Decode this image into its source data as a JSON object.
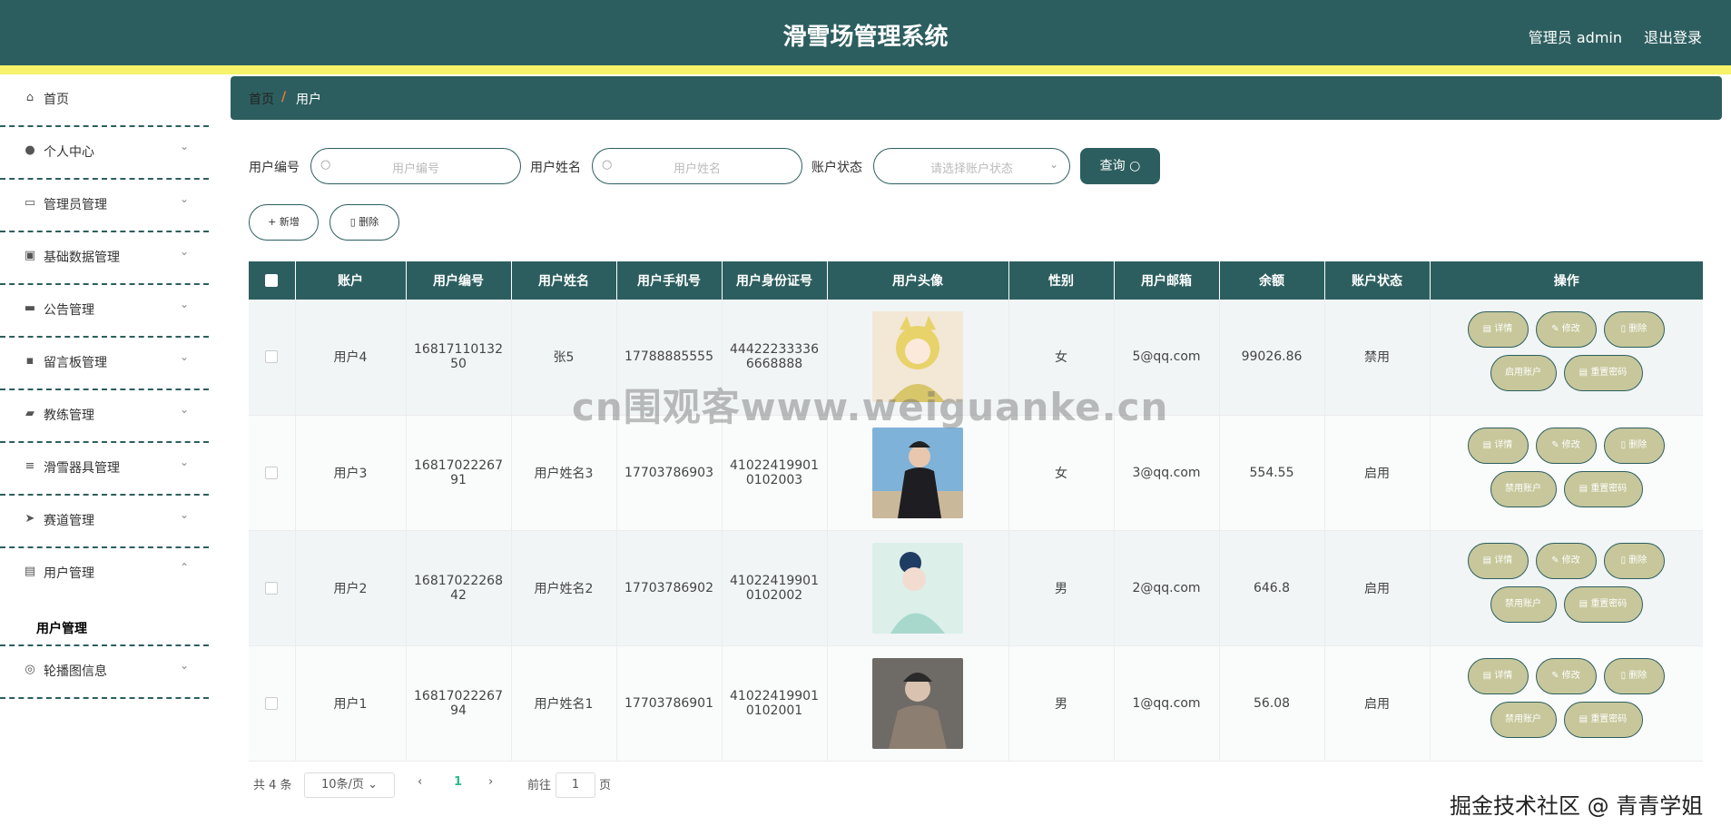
{
  "header": {
    "title": "滑雪场管理系统",
    "user": "管理员 admin",
    "logout": "退出登录"
  },
  "sidebar": {
    "items": [
      {
        "label": "首页",
        "icon": "home-icon",
        "glyph": "⌂",
        "arrow": ""
      },
      {
        "label": "个人中心",
        "icon": "person-icon",
        "glyph": "●",
        "arrow": "⌄"
      },
      {
        "label": "管理员管理",
        "icon": "chat-icon",
        "glyph": "▭",
        "arrow": "⌄"
      },
      {
        "label": "基础数据管理",
        "icon": "clipboard-icon",
        "glyph": "▣",
        "arrow": "⌄"
      },
      {
        "label": "公告管理",
        "icon": "podium-icon",
        "glyph": "▬",
        "arrow": "⌄"
      },
      {
        "label": "留言板管理",
        "icon": "message-icon",
        "glyph": "▪",
        "arrow": "⌄"
      },
      {
        "label": "教练管理",
        "icon": "truck-icon",
        "glyph": "▰",
        "arrow": "⌄"
      },
      {
        "label": "滑雪器具管理",
        "icon": "list-icon",
        "glyph": "≡",
        "arrow": "⌄"
      },
      {
        "label": "赛道管理",
        "icon": "send-icon",
        "glyph": "➤",
        "arrow": "⌄"
      },
      {
        "label": "用户管理",
        "icon": "doc-icon",
        "glyph": "▤",
        "arrow": "⌃"
      },
      {
        "label": "轮播图信息",
        "icon": "gauge-icon",
        "glyph": "◎",
        "arrow": "⌄"
      }
    ],
    "submenu_label": "用户管理"
  },
  "breadcrumb": {
    "home": "首页",
    "sep": "/",
    "current": "用户"
  },
  "search": {
    "id_label": "用户编号",
    "id_placeholder": "用户编号",
    "name_label": "用户姓名",
    "name_placeholder": "用户姓名",
    "status_label": "账户状态",
    "status_placeholder": "请选择账户状态",
    "query_label": "查询"
  },
  "actions": {
    "add": "+ 新增",
    "delete": "删除"
  },
  "table": {
    "headers": [
      "账户",
      "用户编号",
      "用户姓名",
      "用户手机号",
      "用户身份证号",
      "用户头像",
      "性别",
      "用户邮箱",
      "余额",
      "账户状态",
      "操作"
    ],
    "rows": [
      {
        "account": "用户4",
        "id_a": "16817110132",
        "id_b": "50",
        "name": "张5",
        "phone": "17788885555",
        "idcard_a": "44422233336",
        "idcard_b": "6668888",
        "gender": "女",
        "email": "5@qq.com",
        "balance": "99026.86",
        "status": "禁用",
        "toggle": "启用账户"
      },
      {
        "account": "用户3",
        "id_a": "16817022267",
        "id_b": "91",
        "name": "用户姓名3",
        "phone": "17703786903",
        "idcard_a": "41022419901",
        "idcard_b": "0102003",
        "gender": "女",
        "email": "3@qq.com",
        "balance": "554.55",
        "status": "启用",
        "toggle": "禁用账户"
      },
      {
        "account": "用户2",
        "id_a": "16817022268",
        "id_b": "42",
        "name": "用户姓名2",
        "phone": "17703786902",
        "idcard_a": "41022419901",
        "idcard_b": "0102002",
        "gender": "男",
        "email": "2@qq.com",
        "balance": "646.8",
        "status": "启用",
        "toggle": "禁用账户"
      },
      {
        "account": "用户1",
        "id_a": "16817022267",
        "id_b": "94",
        "name": "用户姓名1",
        "phone": "17703786901",
        "idcard_a": "41022419901",
        "idcard_b": "0102001",
        "gender": "男",
        "email": "1@qq.com",
        "balance": "56.08",
        "status": "启用",
        "toggle": "禁用账户"
      }
    ],
    "op_labels": {
      "detail": "详情",
      "edit": "修改",
      "delete": "删除",
      "reset": "重置密码"
    }
  },
  "pagination": {
    "total": "共 4 条",
    "page_size": "10条/页",
    "current": "1",
    "goto_prefix": "前往",
    "goto_value": "1",
    "goto_suffix": "页"
  },
  "watermarks": {
    "center": "cn围观客www.weiguanke.cn",
    "bottom_right": "掘金技术社区 @ 青青学姐"
  },
  "colors": {
    "primary": "#2d5e5f",
    "accent_yellow": "#f6f36a",
    "op_button": "#c7c79b",
    "active_page": "#2dbb8c"
  }
}
